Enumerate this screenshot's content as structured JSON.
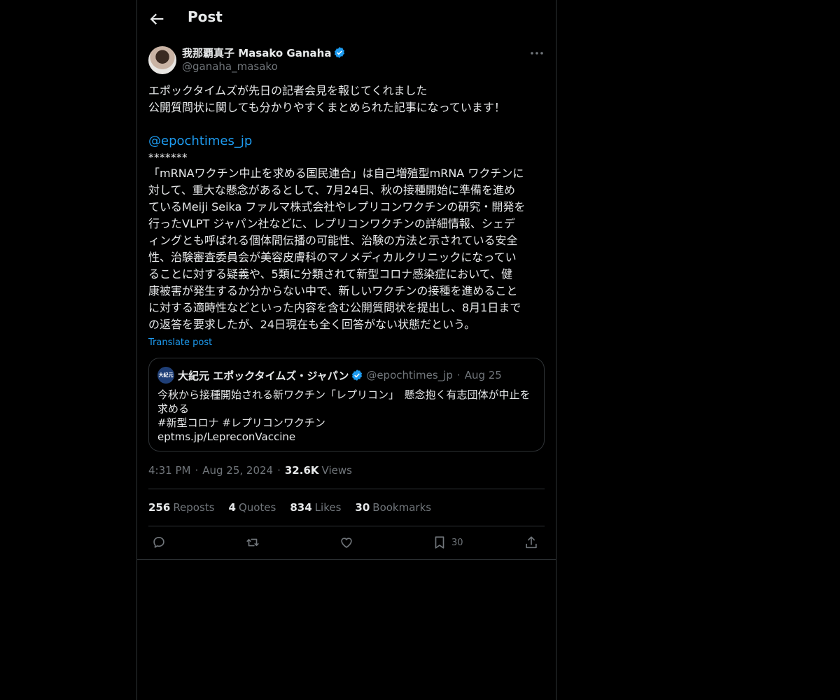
{
  "header": {
    "title": "Post",
    "back_icon": "arrow-left-icon"
  },
  "author": {
    "display_name": "我那覇真子 Masako Ganaha",
    "handle": "@ganaha_masako",
    "verified": true
  },
  "post": {
    "lines_intro": [
      "エポックタイムズが先日の記者会見を報じてくれました",
      "公開質問状に関しても分かりやすくまとめられた記事になっています！"
    ],
    "mention": "@epochtimes_jp",
    "separator": "*******",
    "lines_body": [
      "「mRNAワクチン中止を求める国民連合」は自己増殖型mRNA ワクチンに",
      "対して、重大な懸念があるとして、7月24日、秋の接種開始に準備を進め",
      "ているMeiji Seika ファルマ株式会社やレプリコンワクチンの研究・開発を",
      "行ったVLPT ジャパン社などに、レプリコンワクチンの詳細情報、シェデ",
      "ィングとも呼ばれる個体間伝播の可能性、治験の方法と示されている安全",
      "性、治験審査委員会が美容皮膚科のマノメディカルクリニックになってい",
      "ることに対する疑義や、5類に分類されて新型コロナ感染症において、健",
      "康被害が発生するか分からない中で、新しいワクチンの接種を進めること",
      "に対する適時性などといった内容を含む公開質問状を提出し、8月1日まで",
      "の返答を要求したが、24日現在も全く回答がない状態だという。"
    ],
    "translate_label": "Translate post"
  },
  "quote": {
    "display_name": "大紀元 エポックタイムズ・ジャパン",
    "handle": "@epochtimes_jp",
    "date": "Aug 25",
    "avatar_text": "大紀元",
    "lines": [
      "今秋から接種開始される新ワクチン「レプリコン」　懸念抱く有志団体が中止を",
      "求める",
      "#新型コロナ #レプリコンワクチン",
      "eptms.jp/LepreconVaccine"
    ]
  },
  "meta": {
    "time": "4:31 PM",
    "date": "Aug 25, 2024",
    "views_count": "32.6K",
    "views_label": "Views"
  },
  "stats": {
    "reposts_count": "256",
    "reposts_label": "Reposts",
    "quotes_count": "4",
    "quotes_label": "Quotes",
    "likes_count": "834",
    "likes_label": "Likes",
    "bookmarks_count": "30",
    "bookmarks_label": "Bookmarks"
  },
  "actions": {
    "reply_icon": "reply-icon",
    "repost_icon": "repost-icon",
    "like_icon": "heart-icon",
    "bookmark_icon": "bookmark-icon",
    "bookmark_count": "30",
    "share_icon": "share-icon"
  },
  "colors": {
    "background": "#000000",
    "text": "#e7e9ea",
    "secondary": "#71767b",
    "accent": "#1d9bf0",
    "border": "#2f3336"
  }
}
